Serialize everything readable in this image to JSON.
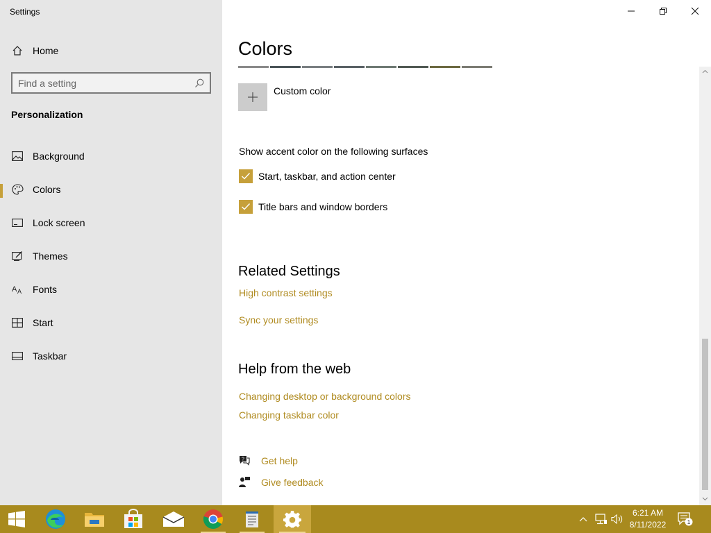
{
  "window": {
    "title": "Settings",
    "minimize_icon": "minimize-icon",
    "restore_icon": "restore-icon",
    "close_icon": "close-icon"
  },
  "sidebar": {
    "home_label": "Home",
    "search_placeholder": "Find a setting",
    "section_title": "Personalization",
    "items": [
      {
        "label": "Background",
        "icon": "picture-icon"
      },
      {
        "label": "Colors",
        "icon": "palette-icon",
        "selected": true
      },
      {
        "label": "Lock screen",
        "icon": "lock-screen-icon"
      },
      {
        "label": "Themes",
        "icon": "themes-icon"
      },
      {
        "label": "Fonts",
        "icon": "fonts-icon"
      },
      {
        "label": "Start",
        "icon": "start-icon"
      },
      {
        "label": "Taskbar",
        "icon": "taskbar-icon"
      }
    ]
  },
  "content": {
    "title": "Colors",
    "swatch_colors": [
      "#8a8a8a",
      "#4a5458",
      "#7a7f82",
      "#5a6266",
      "#6f7a74",
      "#525a55",
      "#6d6a42",
      "#7c7c74"
    ],
    "custom_color_label": "Custom color",
    "accent_surfaces_label": "Show accent color on the following surfaces",
    "checkboxes": [
      {
        "label": "Start, taskbar, and action center",
        "checked": true
      },
      {
        "label": "Title bars and window borders",
        "checked": true
      }
    ],
    "related_settings": {
      "heading": "Related Settings",
      "links": [
        "High contrast settings",
        "Sync your settings"
      ]
    },
    "help_from_web": {
      "heading": "Help from the web",
      "links": [
        "Changing desktop or background colors",
        "Changing taskbar color"
      ]
    },
    "get_help_label": "Get help",
    "give_feedback_label": "Give feedback"
  },
  "taskbar": {
    "apps": [
      "start-button",
      "edge-icon",
      "file-explorer-icon",
      "store-icon",
      "mail-icon",
      "chrome-icon",
      "notepad-icon",
      "settings-icon"
    ],
    "time": "6:21 AM",
    "date": "8/11/2022",
    "notification_count": "1"
  },
  "colors": {
    "accent": "#c6a03a",
    "link": "#b08b20",
    "taskbar": "#a88a1e",
    "sidebar_bg": "#e6e6e6"
  }
}
